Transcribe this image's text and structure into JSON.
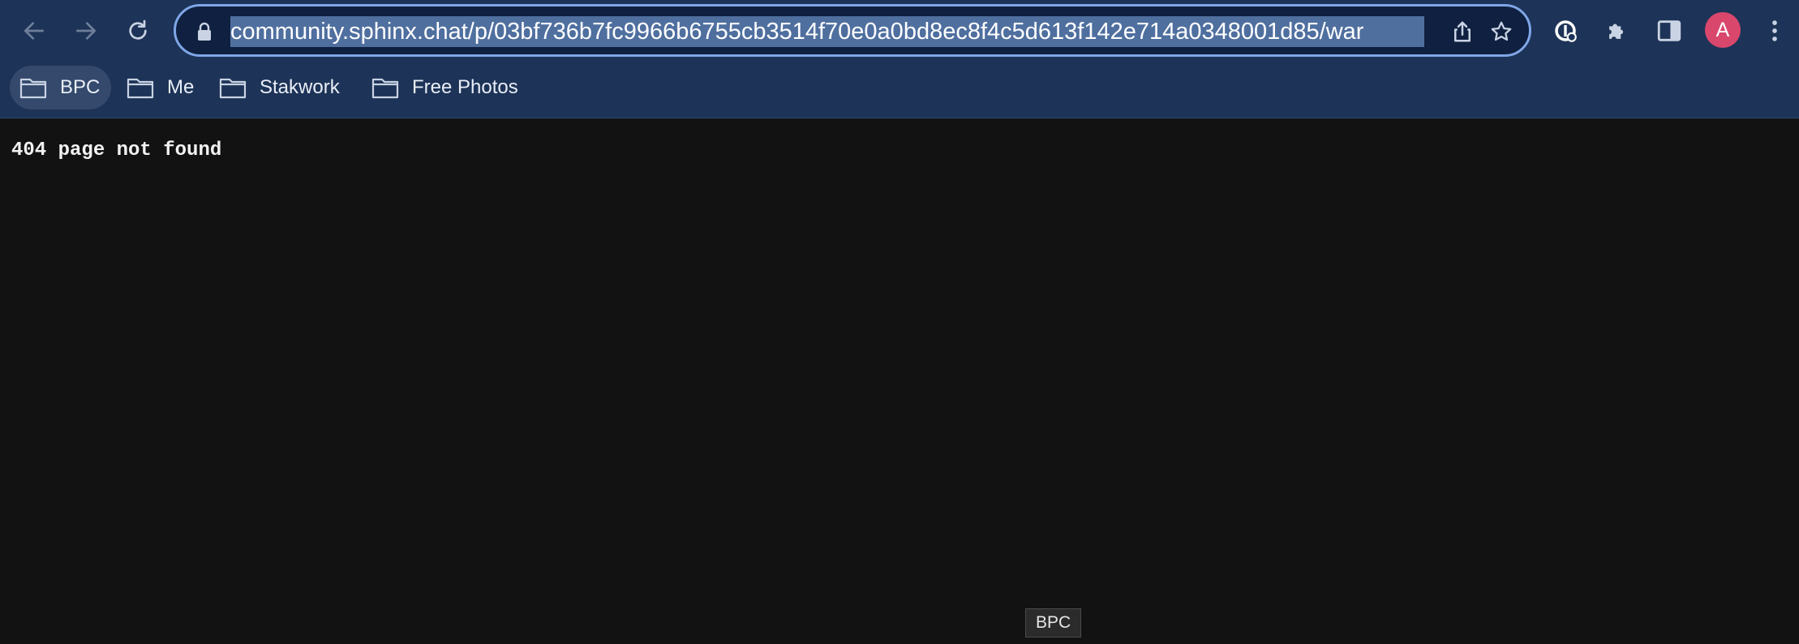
{
  "browser": {
    "url": "community.sphinx.chat/p/03bf736b7fc9966b6755cb3514f70e0a0bd8ec8f4c5d613f142e714a0348001d85/war",
    "profile_initial": "A",
    "accent_color": "#7fa6e6",
    "icons": [
      "back-arrow-icon",
      "forward-arrow-icon",
      "reload-icon",
      "lock-icon",
      "share-icon",
      "star-icon",
      "extension-password-icon",
      "puzzle-icon",
      "side-panel-icon",
      "more-vert-icon"
    ]
  },
  "bookmarks": [
    {
      "label": "BPC"
    },
    {
      "label": "Me"
    },
    {
      "label": "Stakwork"
    },
    {
      "label": "Free Photos"
    }
  ],
  "page": {
    "message": "404 page not found"
  },
  "tooltip": {
    "text": "BPC"
  }
}
